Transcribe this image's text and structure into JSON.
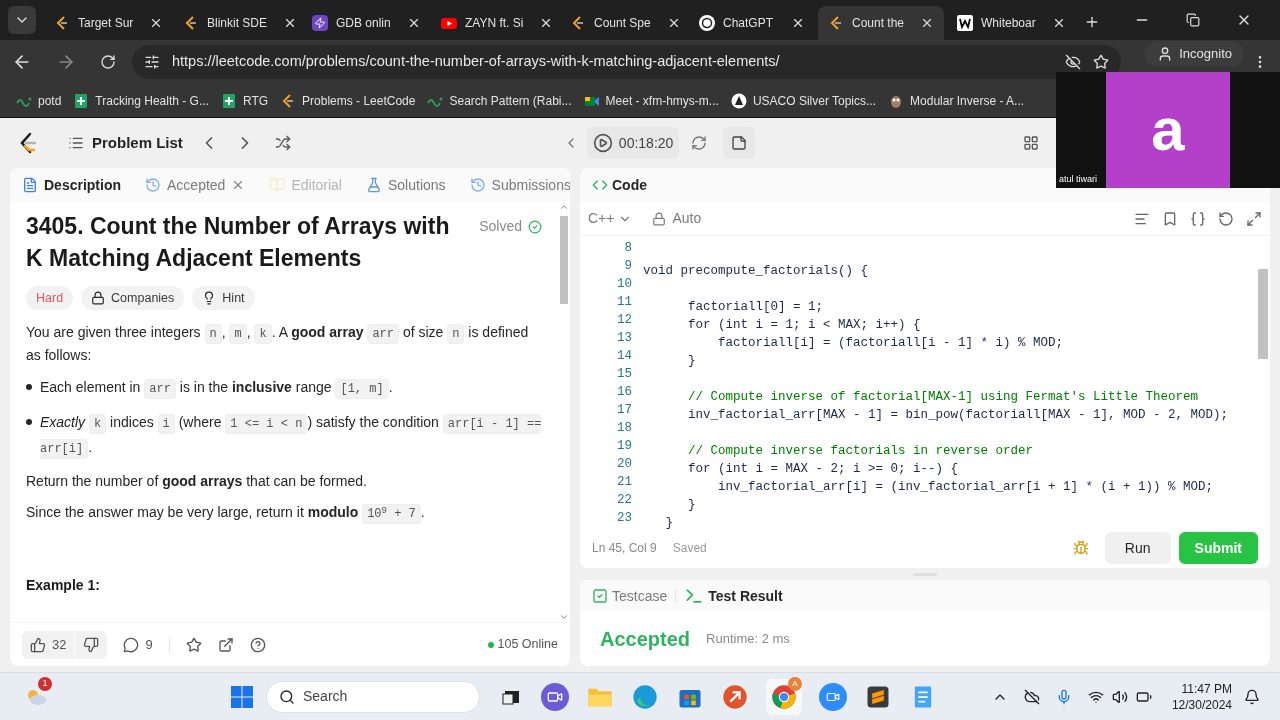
{
  "browser": {
    "tabs": [
      {
        "title": "Target Sur",
        "selected": false
      },
      {
        "title": "Blinkit SDE",
        "selected": false
      },
      {
        "title": "GDB onlin",
        "selected": false
      },
      {
        "title": "ZAYN ft. Si",
        "selected": false
      },
      {
        "title": "Count Spe",
        "selected": false
      },
      {
        "title": "ChatGPT",
        "selected": false
      },
      {
        "title": "Count the",
        "selected": true
      },
      {
        "title": "Whiteboar",
        "selected": false
      }
    ],
    "url": "https://leetcode.com/problems/count-the-number-of-arrays-with-k-matching-adjacent-elements/",
    "profile": "Incognito",
    "bookmarks": [
      {
        "title": "potd"
      },
      {
        "title": "Tracking Health - G..."
      },
      {
        "title": "RTG"
      },
      {
        "title": "Problems - LeetCode"
      },
      {
        "title": "Search Pattern (Rabi..."
      },
      {
        "title": "Meet - xfm-hmys-m..."
      },
      {
        "title": "USACO Silver Topics..."
      },
      {
        "title": "Modular Inverse - A..."
      }
    ]
  },
  "video_call": {
    "initial": "a",
    "name": "atul tiwari"
  },
  "topbar": {
    "problem_list": "Problem List",
    "timer": "00:18:20"
  },
  "description_panel": {
    "tabs": [
      {
        "label": "Description",
        "selected": true,
        "disabled": false,
        "closable": false
      },
      {
        "label": "Accepted",
        "selected": false,
        "disabled": false,
        "closable": true
      },
      {
        "label": "Editorial",
        "selected": false,
        "disabled": true,
        "closable": false
      },
      {
        "label": "Solutions",
        "selected": false,
        "disabled": false,
        "closable": false
      },
      {
        "label": "Submissions",
        "selected": false,
        "disabled": false,
        "closable": false
      }
    ],
    "title": "3405. Count the Number of Arrays with K Matching Adjacent Elements",
    "status": "Solved",
    "tags": [
      {
        "label": "Hard",
        "kind": "difficulty"
      },
      {
        "label": "Companies",
        "kind": "companies"
      },
      {
        "label": "Hint",
        "kind": "hint"
      }
    ],
    "paragraphs": [
      {
        "kind": "paragraph",
        "segments": [
          {
            "kind": "text",
            "text": "You are given three integers "
          },
          {
            "kind": "code",
            "text": "n"
          },
          {
            "kind": "text",
            "text": ", "
          },
          {
            "kind": "code",
            "text": "m"
          },
          {
            "kind": "text",
            "text": ", "
          },
          {
            "kind": "code",
            "text": "k"
          },
          {
            "kind": "text",
            "text": ". A "
          },
          {
            "kind": "bold",
            "text": "good array "
          },
          {
            "kind": "code",
            "text": "arr"
          },
          {
            "kind": "text",
            "text": " of size "
          },
          {
            "kind": "code",
            "text": "n"
          },
          {
            "kind": "text",
            "text": " is defined as follows:"
          }
        ]
      },
      {
        "kind": "bullet",
        "segments": [
          {
            "kind": "text",
            "text": "Each element in "
          },
          {
            "kind": "code",
            "text": "arr"
          },
          {
            "kind": "text",
            "text": " is in the "
          },
          {
            "kind": "bold",
            "text": "inclusive"
          },
          {
            "kind": "text",
            "text": " range "
          },
          {
            "kind": "code",
            "text": "[1, m]"
          },
          {
            "kind": "text",
            "text": "."
          }
        ]
      },
      {
        "kind": "bullet",
        "segments": [
          {
            "kind": "italic",
            "text": "Exactly "
          },
          {
            "kind": "code",
            "text": "k"
          },
          {
            "kind": "text",
            "text": " indices "
          },
          {
            "kind": "code",
            "text": "i"
          },
          {
            "kind": "text",
            "text": " (where "
          },
          {
            "kind": "code",
            "text": "1 <= i < n"
          },
          {
            "kind": "text",
            "text": ") satisfy the condition "
          },
          {
            "kind": "code",
            "text": "arr[i - 1] == arr[i]"
          },
          {
            "kind": "text",
            "text": "."
          }
        ]
      },
      {
        "kind": "paragraph",
        "segments": [
          {
            "kind": "text",
            "text": "Return the number of "
          },
          {
            "kind": "bold",
            "text": "good arrays"
          },
          {
            "kind": "text",
            "text": " that can be formed."
          }
        ]
      },
      {
        "kind": "paragraph",
        "segments": [
          {
            "kind": "text",
            "text": "Since the answer may be very large, return it "
          },
          {
            "kind": "bold",
            "text": "modulo "
          },
          {
            "kind": "code",
            "text": "10$^{9}$ + 7"
          },
          {
            "kind": "text",
            "text": "."
          }
        ]
      }
    ],
    "example_heading": "Example 1:",
    "footer": {
      "likes": "32",
      "comments": "9",
      "online": "105 Online"
    }
  },
  "editor": {
    "title": "Code",
    "language": "C++",
    "mode": "Auto",
    "lines": [
      {
        "number": "8"
      },
      {
        "number": "9",
        "kind": "code",
        "text": "void precompute_factorials() {"
      },
      {
        "number": "10"
      },
      {
        "number": "11",
        "kind": "code",
        "text": "      factoriall[0] = 1;"
      },
      {
        "number": "12",
        "kind": "code",
        "text": "      for (int i = 1; i < MAX; i++) {"
      },
      {
        "number": "13",
        "kind": "code",
        "text": "          factoriall[i] = (factoriall[i - 1] * i) % MOD;"
      },
      {
        "number": "14",
        "kind": "code",
        "text": "      }"
      },
      {
        "number": "15"
      },
      {
        "number": "16",
        "kind": "comment",
        "text": "      // Compute inverse of factorial[MAX-1] using Fermat's Little Theorem"
      },
      {
        "number": "17",
        "kind": "code",
        "text": "      inv_factorial_arr[MAX - 1] = bin_pow(factoriall[MAX - 1], MOD - 2, MOD);"
      },
      {
        "number": "18"
      },
      {
        "number": "19",
        "kind": "comment",
        "text": "      // Compute inverse factorials in reverse order"
      },
      {
        "number": "20",
        "kind": "code",
        "text": "      for (int i = MAX - 2; i >= 0; i--) {"
      },
      {
        "number": "21",
        "kind": "code",
        "text": "          inv_factorial_arr[i] = (inv_factorial_arr[i + 1] * (i + 1)) % MOD;"
      },
      {
        "number": "22",
        "kind": "code",
        "text": "      }"
      },
      {
        "number": "23",
        "kind": "code",
        "text": "   }"
      }
    ],
    "position": "Ln 45, Col 9",
    "save_state": "Saved",
    "run": "Run",
    "submit": "Submit"
  },
  "results": {
    "tabs": [
      {
        "label": "Testcase",
        "selected": false
      },
      {
        "label": "Test Result",
        "selected": true
      }
    ],
    "verdict": "Accepted",
    "runtime": "Runtime: 2 ms"
  },
  "taskbar": {
    "notification_count": "1",
    "search_placeholder": "Search",
    "browser_badge": "A",
    "time": "11:47 PM",
    "date": "12/30/2024"
  }
}
